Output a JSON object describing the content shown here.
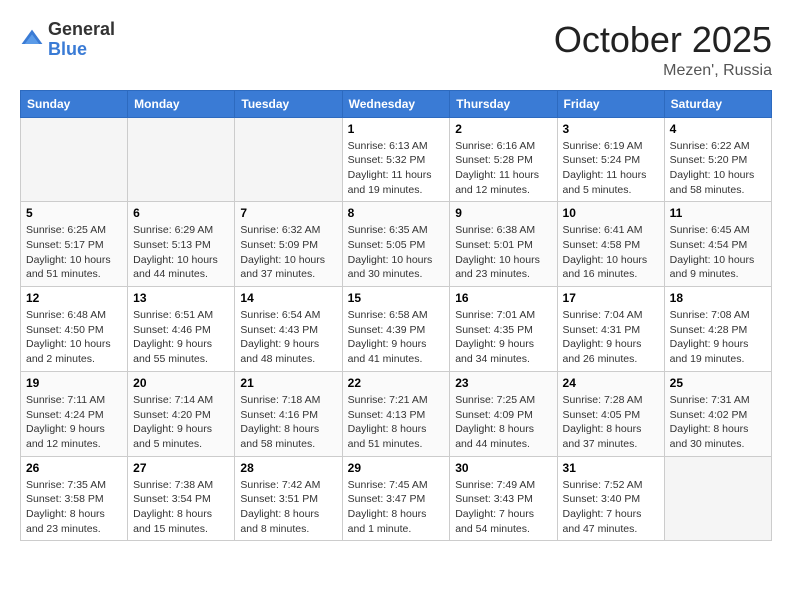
{
  "header": {
    "logo_general": "General",
    "logo_blue": "Blue",
    "month": "October 2025",
    "location": "Mezen', Russia"
  },
  "weekdays": [
    "Sunday",
    "Monday",
    "Tuesday",
    "Wednesday",
    "Thursday",
    "Friday",
    "Saturday"
  ],
  "weeks": [
    [
      {
        "day": "",
        "details": ""
      },
      {
        "day": "",
        "details": ""
      },
      {
        "day": "",
        "details": ""
      },
      {
        "day": "1",
        "details": "Sunrise: 6:13 AM\nSunset: 5:32 PM\nDaylight: 11 hours\nand 19 minutes."
      },
      {
        "day": "2",
        "details": "Sunrise: 6:16 AM\nSunset: 5:28 PM\nDaylight: 11 hours\nand 12 minutes."
      },
      {
        "day": "3",
        "details": "Sunrise: 6:19 AM\nSunset: 5:24 PM\nDaylight: 11 hours\nand 5 minutes."
      },
      {
        "day": "4",
        "details": "Sunrise: 6:22 AM\nSunset: 5:20 PM\nDaylight: 10 hours\nand 58 minutes."
      }
    ],
    [
      {
        "day": "5",
        "details": "Sunrise: 6:25 AM\nSunset: 5:17 PM\nDaylight: 10 hours\nand 51 minutes."
      },
      {
        "day": "6",
        "details": "Sunrise: 6:29 AM\nSunset: 5:13 PM\nDaylight: 10 hours\nand 44 minutes."
      },
      {
        "day": "7",
        "details": "Sunrise: 6:32 AM\nSunset: 5:09 PM\nDaylight: 10 hours\nand 37 minutes."
      },
      {
        "day": "8",
        "details": "Sunrise: 6:35 AM\nSunset: 5:05 PM\nDaylight: 10 hours\nand 30 minutes."
      },
      {
        "day": "9",
        "details": "Sunrise: 6:38 AM\nSunset: 5:01 PM\nDaylight: 10 hours\nand 23 minutes."
      },
      {
        "day": "10",
        "details": "Sunrise: 6:41 AM\nSunset: 4:58 PM\nDaylight: 10 hours\nand 16 minutes."
      },
      {
        "day": "11",
        "details": "Sunrise: 6:45 AM\nSunset: 4:54 PM\nDaylight: 10 hours\nand 9 minutes."
      }
    ],
    [
      {
        "day": "12",
        "details": "Sunrise: 6:48 AM\nSunset: 4:50 PM\nDaylight: 10 hours\nand 2 minutes."
      },
      {
        "day": "13",
        "details": "Sunrise: 6:51 AM\nSunset: 4:46 PM\nDaylight: 9 hours\nand 55 minutes."
      },
      {
        "day": "14",
        "details": "Sunrise: 6:54 AM\nSunset: 4:43 PM\nDaylight: 9 hours\nand 48 minutes."
      },
      {
        "day": "15",
        "details": "Sunrise: 6:58 AM\nSunset: 4:39 PM\nDaylight: 9 hours\nand 41 minutes."
      },
      {
        "day": "16",
        "details": "Sunrise: 7:01 AM\nSunset: 4:35 PM\nDaylight: 9 hours\nand 34 minutes."
      },
      {
        "day": "17",
        "details": "Sunrise: 7:04 AM\nSunset: 4:31 PM\nDaylight: 9 hours\nand 26 minutes."
      },
      {
        "day": "18",
        "details": "Sunrise: 7:08 AM\nSunset: 4:28 PM\nDaylight: 9 hours\nand 19 minutes."
      }
    ],
    [
      {
        "day": "19",
        "details": "Sunrise: 7:11 AM\nSunset: 4:24 PM\nDaylight: 9 hours\nand 12 minutes."
      },
      {
        "day": "20",
        "details": "Sunrise: 7:14 AM\nSunset: 4:20 PM\nDaylight: 9 hours\nand 5 minutes."
      },
      {
        "day": "21",
        "details": "Sunrise: 7:18 AM\nSunset: 4:16 PM\nDaylight: 8 hours\nand 58 minutes."
      },
      {
        "day": "22",
        "details": "Sunrise: 7:21 AM\nSunset: 4:13 PM\nDaylight: 8 hours\nand 51 minutes."
      },
      {
        "day": "23",
        "details": "Sunrise: 7:25 AM\nSunset: 4:09 PM\nDaylight: 8 hours\nand 44 minutes."
      },
      {
        "day": "24",
        "details": "Sunrise: 7:28 AM\nSunset: 4:05 PM\nDaylight: 8 hours\nand 37 minutes."
      },
      {
        "day": "25",
        "details": "Sunrise: 7:31 AM\nSunset: 4:02 PM\nDaylight: 8 hours\nand 30 minutes."
      }
    ],
    [
      {
        "day": "26",
        "details": "Sunrise: 7:35 AM\nSunset: 3:58 PM\nDaylight: 8 hours\nand 23 minutes."
      },
      {
        "day": "27",
        "details": "Sunrise: 7:38 AM\nSunset: 3:54 PM\nDaylight: 8 hours\nand 15 minutes."
      },
      {
        "day": "28",
        "details": "Sunrise: 7:42 AM\nSunset: 3:51 PM\nDaylight: 8 hours\nand 8 minutes."
      },
      {
        "day": "29",
        "details": "Sunrise: 7:45 AM\nSunset: 3:47 PM\nDaylight: 8 hours\nand 1 minute."
      },
      {
        "day": "30",
        "details": "Sunrise: 7:49 AM\nSunset: 3:43 PM\nDaylight: 7 hours\nand 54 minutes."
      },
      {
        "day": "31",
        "details": "Sunrise: 7:52 AM\nSunset: 3:40 PM\nDaylight: 7 hours\nand 47 minutes."
      },
      {
        "day": "",
        "details": ""
      }
    ]
  ]
}
